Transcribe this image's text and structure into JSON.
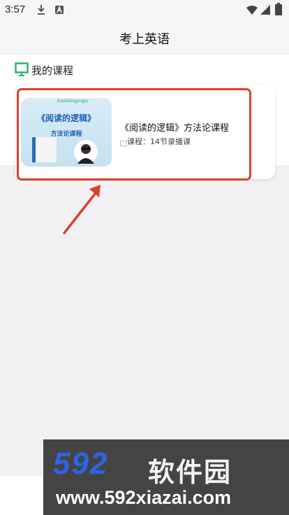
{
  "status_bar": {
    "time": "3:57"
  },
  "header": {
    "title": "考上英语"
  },
  "section": {
    "title": "我的课程"
  },
  "course": {
    "thumbnail": {
      "brand": "Kaoshangyingyu",
      "title": "《阅读的逻辑》",
      "subtitle": "方法论课程"
    },
    "name": "《阅读的逻辑》方法论课程",
    "info": "课程：14节录播课"
  },
  "watermark": {
    "logo": "592",
    "brand_cn": "软件园",
    "url": "www.592xiazai.com"
  },
  "colors": {
    "accent_green": "#2fb36a",
    "annotation_red": "#d9412e",
    "watermark_blue": "#2b64e9"
  }
}
